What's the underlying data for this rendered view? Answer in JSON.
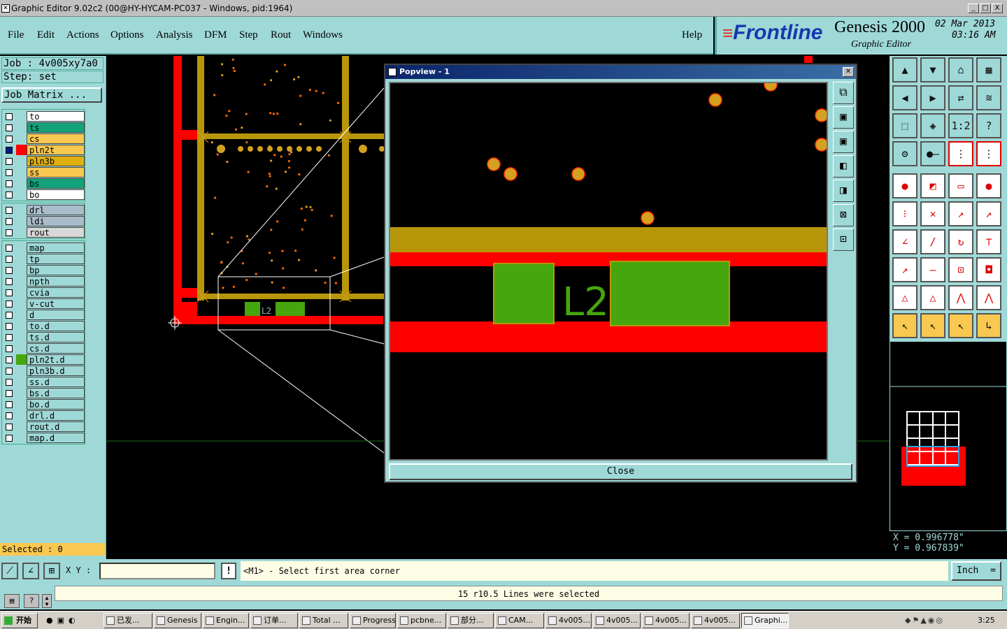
{
  "window": {
    "title": "Graphic Editor 9.02c2 (00@HY-HYCAM-PC037 - Windows, pid:1964)",
    "min": "_",
    "max": "□",
    "close": "X"
  },
  "menu": {
    "items": [
      "File",
      "Edit",
      "Actions",
      "Options",
      "Analysis",
      "DFM",
      "Step",
      "Rout",
      "Windows"
    ],
    "help": "Help"
  },
  "brand": {
    "logo": "Frontline",
    "product": "Genesis 2000",
    "subtitle": "Graphic Editor",
    "date": "02 Mar 2013",
    "time": "03:16 AM"
  },
  "job": {
    "job_line": "Job : 4v005xy7a0",
    "step_line": "Step: set",
    "matrix_button": "Job Matrix ..."
  },
  "layers": {
    "group1": [
      {
        "name": "to",
        "color": "#ffffff"
      },
      {
        "name": "ts",
        "color": "#13a37b"
      },
      {
        "name": "cs",
        "color": "#f9c850"
      },
      {
        "name": "pln2t",
        "color": "#f9c850",
        "active": true,
        "mark": "⊞"
      },
      {
        "name": "pln3b",
        "color": "#e0b010"
      },
      {
        "name": "ss",
        "color": "#f9c850"
      },
      {
        "name": "bs",
        "color": "#13a37b"
      },
      {
        "name": "bo",
        "color": "#ffffff"
      }
    ],
    "group2": [
      {
        "name": "drl",
        "color": "#a9bcc9"
      },
      {
        "name": "ldi",
        "color": "#a9bcc9"
      },
      {
        "name": "rout",
        "color": "#d8d8d8"
      }
    ],
    "group3": [
      {
        "name": "map"
      },
      {
        "name": "tp"
      },
      {
        "name": "bp"
      },
      {
        "name": "npth"
      },
      {
        "name": "cvia"
      },
      {
        "name": "v-cut"
      },
      {
        "name": "d"
      },
      {
        "name": "to.d"
      },
      {
        "name": "ts.d"
      },
      {
        "name": "cs.d"
      },
      {
        "name": "pln2t.d",
        "mark": "↙",
        "swatch": "#46a60d"
      },
      {
        "name": "pln3b.d",
        "mark": "↙"
      },
      {
        "name": "ss.d"
      },
      {
        "name": "bs.d"
      },
      {
        "name": "bo.d"
      },
      {
        "name": "drl.d"
      },
      {
        "name": "rout.d"
      },
      {
        "name": "map.d"
      }
    ]
  },
  "selected": "Selected : 0",
  "popview": {
    "title": "Popview - 1",
    "close_label": "Close",
    "label_text": "L2"
  },
  "canvas_label": "L2",
  "coords": {
    "x": "X = 0.996778\"",
    "y": "Y = 0.967839\""
  },
  "cmd": {
    "xy_label": "X Y :",
    "xy_value": "",
    "prompt": "<M1> - Select first area corner",
    "units": "Inch",
    "units_icon": "="
  },
  "status": {
    "message": "15 r10.5 Lines were selected"
  },
  "taskbar": {
    "start": "开始",
    "tasks": [
      "已发...",
      "Genesis",
      "Engin...",
      "订单...",
      "Total ...",
      "Progress",
      "pcbne...",
      "部分...",
      "CAM...",
      "4v005...",
      "4v005...",
      "4v005...",
      "4v005...",
      "Graphi..."
    ],
    "clock": "3:25"
  },
  "colors": {
    "panel": "#9fd9d7",
    "red": "#ff0000",
    "gold": "#b8960a",
    "green": "#46a60d",
    "pad": "#d4a020"
  }
}
